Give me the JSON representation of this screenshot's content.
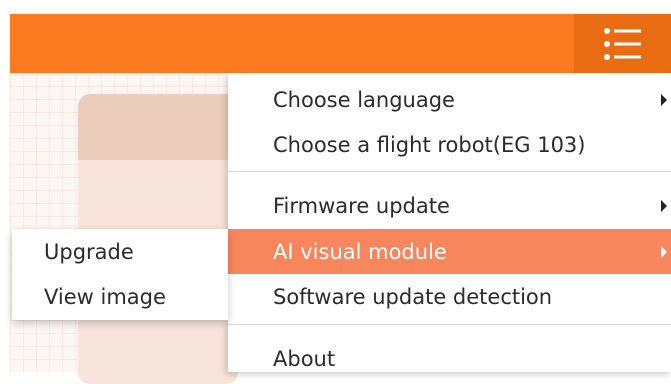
{
  "header": {
    "menu_icon": "hamburger-list-icon",
    "accent_color": "#fc7a1f"
  },
  "menu": {
    "items": [
      {
        "label": "Choose language",
        "has_submenu": true
      },
      {
        "label": "Choose a flight robot(EG 103)",
        "has_submenu": false
      },
      {
        "label": "Firmware update",
        "has_submenu": true
      },
      {
        "label": "AI visual module",
        "has_submenu": true,
        "highlighted": true
      },
      {
        "label": "Software update detection",
        "has_submenu": false
      },
      {
        "label": "About",
        "has_submenu": false
      }
    ],
    "highlight_color": "#f8865d"
  },
  "submenu": {
    "items": [
      {
        "label": "Upgrade"
      },
      {
        "label": "View image"
      }
    ]
  }
}
